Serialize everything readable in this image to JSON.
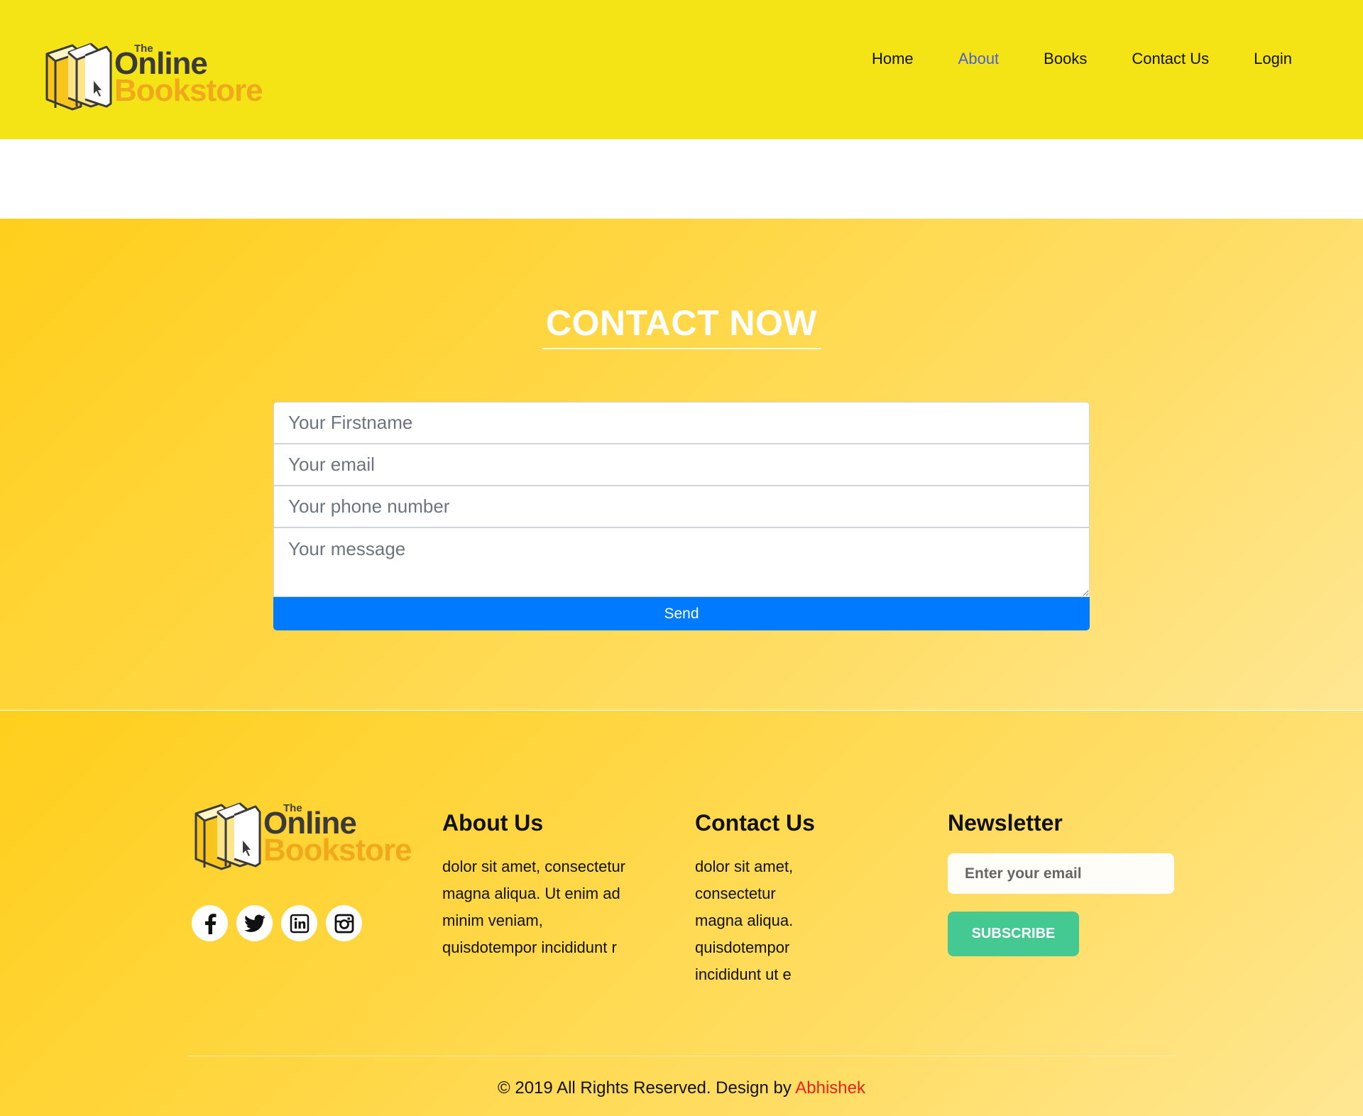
{
  "header": {
    "logo": {
      "the": "The",
      "online": "Online",
      "bookstore": "Bookstore"
    },
    "nav": [
      {
        "label": "Home"
      },
      {
        "label": "About",
        "active": true
      },
      {
        "label": "Books"
      },
      {
        "label": "Contact Us"
      },
      {
        "label": "Login"
      }
    ]
  },
  "contact": {
    "title": "CONTACT NOW",
    "fields": {
      "firstname_placeholder": "Your Firstname",
      "email_placeholder": "Your email",
      "phone_placeholder": "Your phone number",
      "message_placeholder": "Your message"
    },
    "send_label": "Send"
  },
  "footer": {
    "logo": {
      "the": "The",
      "online": "Online",
      "bookstore": "Bookstore"
    },
    "socials": [
      "facebook-icon",
      "twitter-icon",
      "linkedin-icon",
      "instagram-icon"
    ],
    "about": {
      "heading": "About Us",
      "lines": [
        "dolor sit amet, consectetur",
        "magna aliqua. Ut enim ad",
        "minim veniam,",
        "quisdotempor incididunt r"
      ]
    },
    "contact": {
      "heading": "Contact Us",
      "lines": [
        "dolor sit amet,",
        "consectetur",
        "magna aliqua.",
        "quisdotempor",
        "incididunt ut e"
      ]
    },
    "newsletter": {
      "heading": "Newsletter",
      "email_placeholder": "Enter your email",
      "subscribe_label": "SUBSCRIBE"
    },
    "copyright_text": "© 2019 All Rights Reserved. Design by",
    "designer": "Abhishek"
  },
  "colors": {
    "header_bg": "#f4e416",
    "nav_active": "#4a60d8",
    "send_button": "#007bff",
    "subscribe_button": "#44c993",
    "designer_link": "#e8231d",
    "logo_book_text": "#f1a91c"
  }
}
